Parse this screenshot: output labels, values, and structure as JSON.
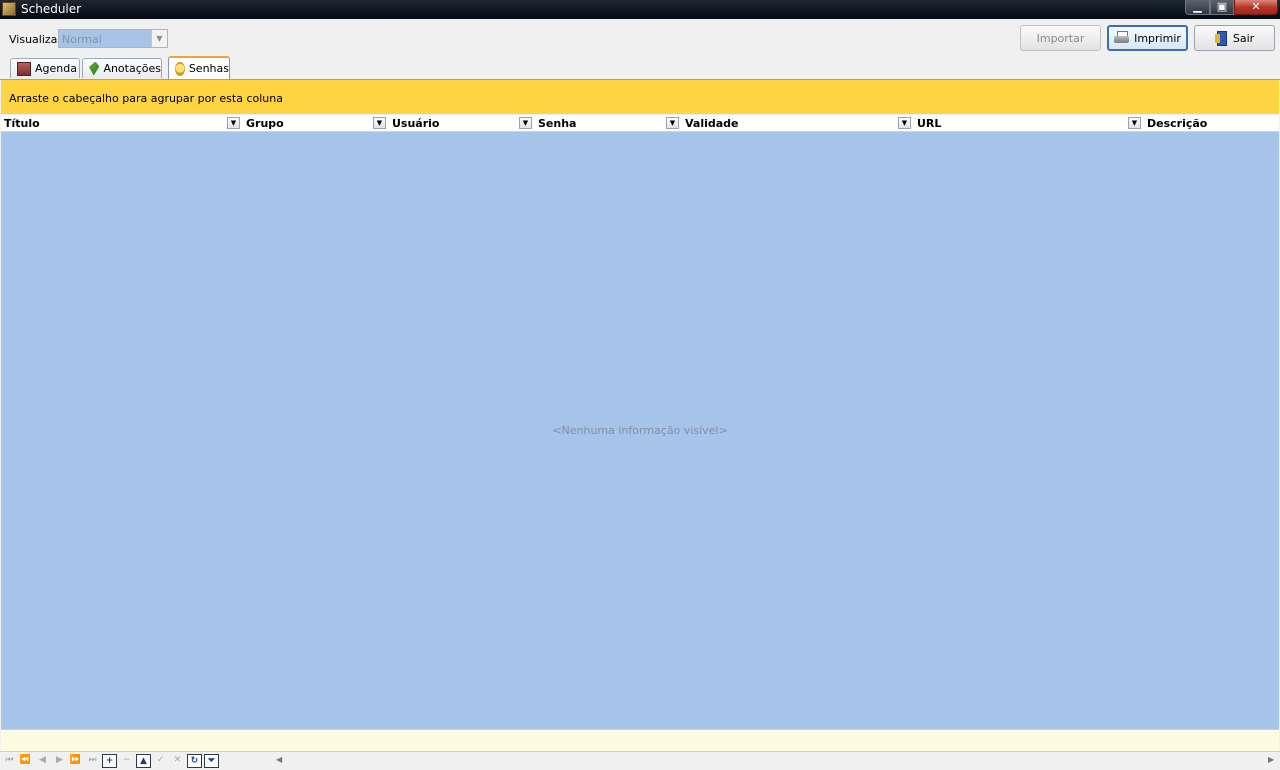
{
  "window": {
    "title": "Scheduler",
    "controls": {
      "minimize": "▁",
      "maximize": "▣",
      "close": "✕"
    }
  },
  "toolbar": {
    "visualizar_label": "Visualizar:",
    "visualizar_value": "Normal",
    "importar_label": "Importar",
    "imprimir_label": "Imprimir",
    "sair_label": "Sair"
  },
  "tabs": [
    {
      "label": "Agenda",
      "icon": "calendar-icon"
    },
    {
      "label": "Anotações",
      "icon": "notes-icon"
    },
    {
      "label": "Senhas",
      "icon": "key-icon",
      "active": true
    }
  ],
  "grid": {
    "group_hint": "Arraste o cabeçalho para agrupar por esta coluna",
    "columns": [
      "Título",
      "Grupo",
      "Usuário",
      "Senha",
      "Validade",
      "URL",
      "Descrição"
    ],
    "empty_text": "<Nenhuma informação visível>"
  },
  "navigator": {
    "buttons": [
      "first",
      "prev-page",
      "prev",
      "next",
      "next-page",
      "last",
      "insert",
      "delete",
      "edit",
      "post",
      "cancel",
      "refresh",
      "filter"
    ]
  },
  "colors": {
    "group_panel": "#ffd443",
    "grid_background": "#a6c4ea",
    "footer_band": "#fffbe0"
  }
}
